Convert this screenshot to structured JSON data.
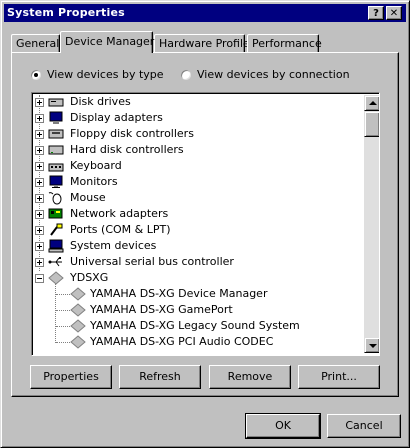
{
  "window": {
    "title": "System Properties"
  },
  "title_buttons": {
    "help": "?",
    "close": "✕"
  },
  "tabs": [
    {
      "label": "General",
      "active": false
    },
    {
      "label": "Device Manager",
      "active": true
    },
    {
      "label": "Hardware Profiles",
      "active": false
    },
    {
      "label": "Performance",
      "active": false
    }
  ],
  "view": {
    "by_type_label": "View devices by type",
    "by_type_selected": true,
    "by_connection_label": "View devices by connection",
    "by_connection_selected": false
  },
  "devices": [
    {
      "label": "Disk drives",
      "icon": "disk-drive-icon",
      "expanded": false
    },
    {
      "label": "Display adapters",
      "icon": "display-adapter-icon",
      "expanded": false
    },
    {
      "label": "Floppy disk controllers",
      "icon": "floppy-controller-icon",
      "expanded": false
    },
    {
      "label": "Hard disk controllers",
      "icon": "hard-disk-controller-icon",
      "expanded": false
    },
    {
      "label": "Keyboard",
      "icon": "keyboard-icon",
      "expanded": false
    },
    {
      "label": "Monitors",
      "icon": "monitor-icon",
      "expanded": false
    },
    {
      "label": "Mouse",
      "icon": "mouse-icon",
      "expanded": false
    },
    {
      "label": "Network adapters",
      "icon": "network-adapter-icon",
      "expanded": false
    },
    {
      "label": "Ports (COM & LPT)",
      "icon": "port-icon",
      "expanded": false
    },
    {
      "label": "System devices",
      "icon": "system-device-icon",
      "expanded": false
    },
    {
      "label": "Universal serial bus controller",
      "icon": "usb-icon",
      "expanded": false
    },
    {
      "label": "YDSXG",
      "icon": "ydsxg-device-icon",
      "expanded": true,
      "children": [
        {
          "label": "YAMAHA DS-XG Device Manager",
          "icon": "ydsxg-device-icon"
        },
        {
          "label": "YAMAHA DS-XG GamePort",
          "icon": "ydsxg-device-icon"
        },
        {
          "label": "YAMAHA DS-XG Legacy Sound System",
          "icon": "ydsxg-device-icon"
        },
        {
          "label": "YAMAHA DS-XG PCI Audio CODEC",
          "icon": "ydsxg-device-icon"
        }
      ]
    }
  ],
  "actions": {
    "properties": "Properties",
    "refresh": "Refresh",
    "remove": "Remove",
    "print": "Print..."
  },
  "dialog": {
    "ok": "OK",
    "cancel": "Cancel"
  },
  "colors": {
    "titlebar": "#000080",
    "face": "#c0c0c0",
    "window": "#ffffff"
  }
}
